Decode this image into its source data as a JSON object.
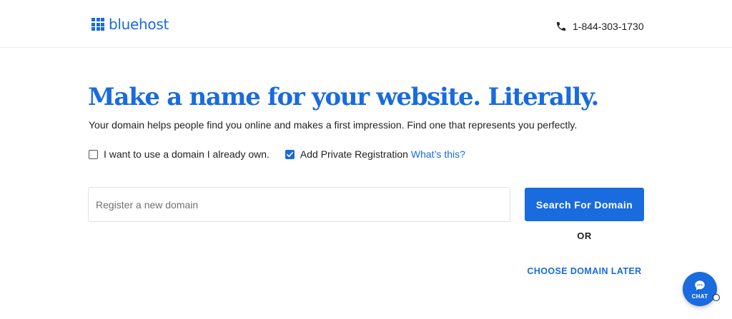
{
  "header": {
    "logo_text": "bluehost",
    "phone": "1-844-303-1730"
  },
  "hero": {
    "headline": "Make a name for your website. Literally.",
    "subtext": "Your domain helps people find you online and makes a first impression. Find one that represents you perfectly."
  },
  "options": {
    "own_domain_label": "I want to use a domain I already own.",
    "own_domain_checked": false,
    "private_registration_label": "Add Private Registration",
    "private_registration_checked": true,
    "whats_this_link": "What’s this?"
  },
  "search": {
    "placeholder": "Register a new domain",
    "value": "",
    "button_label": "Search For Domain"
  },
  "or_label": "OR",
  "choose_later_label": "CHOOSE DOMAIN LATER",
  "chat": {
    "label": "CHAT"
  },
  "colors": {
    "brand_blue": "#196bde",
    "text": "#1f1f1f"
  },
  "icons": [
    "logo-grid-icon",
    "phone-icon",
    "checkbox-empty-icon",
    "checkmark-icon",
    "chat-bubble-icon"
  ]
}
